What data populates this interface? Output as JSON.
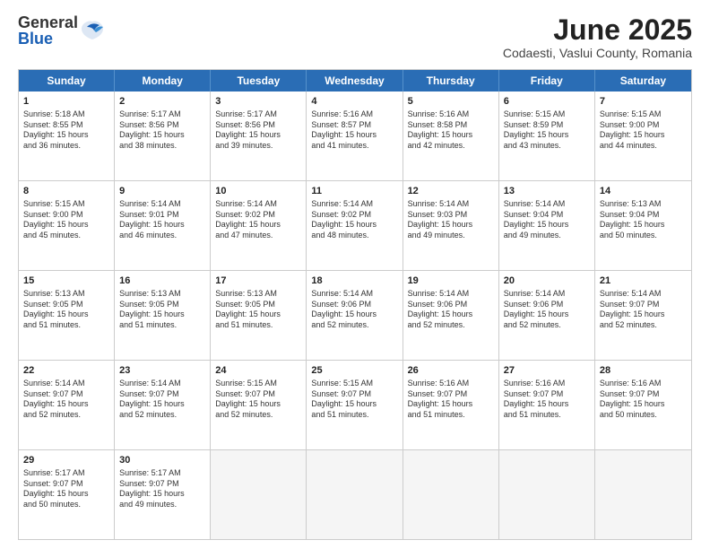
{
  "header": {
    "logo_general": "General",
    "logo_blue": "Blue",
    "title": "June 2025",
    "subtitle": "Codaesti, Vaslui County, Romania"
  },
  "weekdays": [
    "Sunday",
    "Monday",
    "Tuesday",
    "Wednesday",
    "Thursday",
    "Friday",
    "Saturday"
  ],
  "rows": [
    [
      {
        "day": "",
        "info": "",
        "empty": true
      },
      {
        "day": "",
        "info": "",
        "empty": true
      },
      {
        "day": "",
        "info": "",
        "empty": true
      },
      {
        "day": "",
        "info": "",
        "empty": true
      },
      {
        "day": "",
        "info": "",
        "empty": true
      },
      {
        "day": "",
        "info": "",
        "empty": true
      },
      {
        "day": "",
        "info": "",
        "empty": true
      }
    ],
    [
      {
        "day": "1",
        "info": "Sunrise: 5:18 AM\nSunset: 8:55 PM\nDaylight: 15 hours\nand 36 minutes.",
        "empty": false
      },
      {
        "day": "2",
        "info": "Sunrise: 5:17 AM\nSunset: 8:56 PM\nDaylight: 15 hours\nand 38 minutes.",
        "empty": false
      },
      {
        "day": "3",
        "info": "Sunrise: 5:17 AM\nSunset: 8:56 PM\nDaylight: 15 hours\nand 39 minutes.",
        "empty": false
      },
      {
        "day": "4",
        "info": "Sunrise: 5:16 AM\nSunset: 8:57 PM\nDaylight: 15 hours\nand 41 minutes.",
        "empty": false
      },
      {
        "day": "5",
        "info": "Sunrise: 5:16 AM\nSunset: 8:58 PM\nDaylight: 15 hours\nand 42 minutes.",
        "empty": false
      },
      {
        "day": "6",
        "info": "Sunrise: 5:15 AM\nSunset: 8:59 PM\nDaylight: 15 hours\nand 43 minutes.",
        "empty": false
      },
      {
        "day": "7",
        "info": "Sunrise: 5:15 AM\nSunset: 9:00 PM\nDaylight: 15 hours\nand 44 minutes.",
        "empty": false
      }
    ],
    [
      {
        "day": "8",
        "info": "Sunrise: 5:15 AM\nSunset: 9:00 PM\nDaylight: 15 hours\nand 45 minutes.",
        "empty": false
      },
      {
        "day": "9",
        "info": "Sunrise: 5:14 AM\nSunset: 9:01 PM\nDaylight: 15 hours\nand 46 minutes.",
        "empty": false
      },
      {
        "day": "10",
        "info": "Sunrise: 5:14 AM\nSunset: 9:02 PM\nDaylight: 15 hours\nand 47 minutes.",
        "empty": false
      },
      {
        "day": "11",
        "info": "Sunrise: 5:14 AM\nSunset: 9:02 PM\nDaylight: 15 hours\nand 48 minutes.",
        "empty": false
      },
      {
        "day": "12",
        "info": "Sunrise: 5:14 AM\nSunset: 9:03 PM\nDaylight: 15 hours\nand 49 minutes.",
        "empty": false
      },
      {
        "day": "13",
        "info": "Sunrise: 5:14 AM\nSunset: 9:04 PM\nDaylight: 15 hours\nand 49 minutes.",
        "empty": false
      },
      {
        "day": "14",
        "info": "Sunrise: 5:13 AM\nSunset: 9:04 PM\nDaylight: 15 hours\nand 50 minutes.",
        "empty": false
      }
    ],
    [
      {
        "day": "15",
        "info": "Sunrise: 5:13 AM\nSunset: 9:05 PM\nDaylight: 15 hours\nand 51 minutes.",
        "empty": false
      },
      {
        "day": "16",
        "info": "Sunrise: 5:13 AM\nSunset: 9:05 PM\nDaylight: 15 hours\nand 51 minutes.",
        "empty": false
      },
      {
        "day": "17",
        "info": "Sunrise: 5:13 AM\nSunset: 9:05 PM\nDaylight: 15 hours\nand 51 minutes.",
        "empty": false
      },
      {
        "day": "18",
        "info": "Sunrise: 5:14 AM\nSunset: 9:06 PM\nDaylight: 15 hours\nand 52 minutes.",
        "empty": false
      },
      {
        "day": "19",
        "info": "Sunrise: 5:14 AM\nSunset: 9:06 PM\nDaylight: 15 hours\nand 52 minutes.",
        "empty": false
      },
      {
        "day": "20",
        "info": "Sunrise: 5:14 AM\nSunset: 9:06 PM\nDaylight: 15 hours\nand 52 minutes.",
        "empty": false
      },
      {
        "day": "21",
        "info": "Sunrise: 5:14 AM\nSunset: 9:07 PM\nDaylight: 15 hours\nand 52 minutes.",
        "empty": false
      }
    ],
    [
      {
        "day": "22",
        "info": "Sunrise: 5:14 AM\nSunset: 9:07 PM\nDaylight: 15 hours\nand 52 minutes.",
        "empty": false
      },
      {
        "day": "23",
        "info": "Sunrise: 5:14 AM\nSunset: 9:07 PM\nDaylight: 15 hours\nand 52 minutes.",
        "empty": false
      },
      {
        "day": "24",
        "info": "Sunrise: 5:15 AM\nSunset: 9:07 PM\nDaylight: 15 hours\nand 52 minutes.",
        "empty": false
      },
      {
        "day": "25",
        "info": "Sunrise: 5:15 AM\nSunset: 9:07 PM\nDaylight: 15 hours\nand 51 minutes.",
        "empty": false
      },
      {
        "day": "26",
        "info": "Sunrise: 5:16 AM\nSunset: 9:07 PM\nDaylight: 15 hours\nand 51 minutes.",
        "empty": false
      },
      {
        "day": "27",
        "info": "Sunrise: 5:16 AM\nSunset: 9:07 PM\nDaylight: 15 hours\nand 51 minutes.",
        "empty": false
      },
      {
        "day": "28",
        "info": "Sunrise: 5:16 AM\nSunset: 9:07 PM\nDaylight: 15 hours\nand 50 minutes.",
        "empty": false
      }
    ],
    [
      {
        "day": "29",
        "info": "Sunrise: 5:17 AM\nSunset: 9:07 PM\nDaylight: 15 hours\nand 50 minutes.",
        "empty": false
      },
      {
        "day": "30",
        "info": "Sunrise: 5:17 AM\nSunset: 9:07 PM\nDaylight: 15 hours\nand 49 minutes.",
        "empty": false
      },
      {
        "day": "",
        "info": "",
        "empty": true
      },
      {
        "day": "",
        "info": "",
        "empty": true
      },
      {
        "day": "",
        "info": "",
        "empty": true
      },
      {
        "day": "",
        "info": "",
        "empty": true
      },
      {
        "day": "",
        "info": "",
        "empty": true
      }
    ]
  ]
}
